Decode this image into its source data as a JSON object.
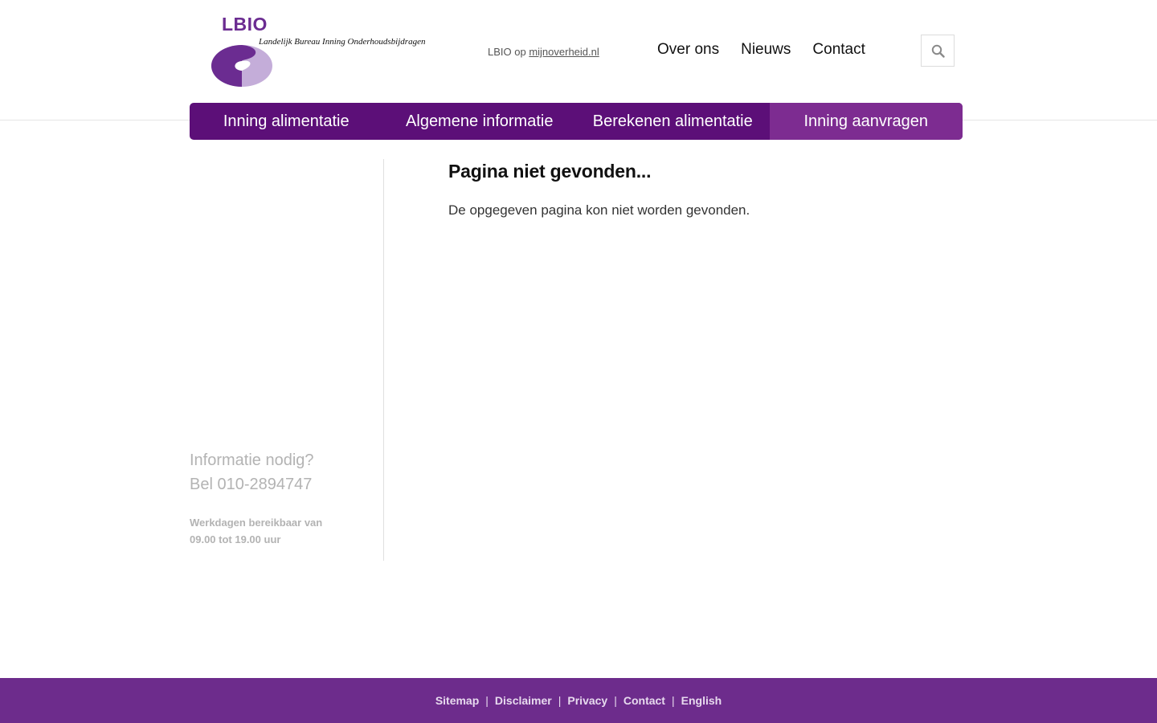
{
  "brand": {
    "name": "LBIO",
    "full_name": "Landelijk Bureau Inning Onderhoudsbijdragen",
    "primary_color": "#5c0f78",
    "accent_color": "#7d2c91",
    "footer_color": "#6d2c8c"
  },
  "header": {
    "mijn_prefix": "LBIO op",
    "mijn_link": "mijnoverheid.nl",
    "top_links": [
      "Over ons",
      "Nieuws",
      "Contact"
    ],
    "search_icon": "search-icon"
  },
  "main_nav": {
    "tabs": [
      {
        "label": "Inning alimentatie",
        "active": false
      },
      {
        "label": "Algemene informatie",
        "active": false
      },
      {
        "label": "Berekenen alimentatie",
        "active": false
      },
      {
        "label": "Inning aanvragen",
        "active": true
      }
    ]
  },
  "sidebar": {
    "info_line1": "Informatie nodig?",
    "info_line2": "Bel 010-2894747",
    "hours_line1": "Werkdagen bereikbaar van",
    "hours_line2": "09.00 tot 19.00 uur"
  },
  "content": {
    "title": "Pagina niet gevonden...",
    "body": "De opgegeven pagina kon niet worden gevonden."
  },
  "footer": {
    "links": [
      "Sitemap",
      "Disclaimer",
      "Privacy",
      "Contact",
      "English"
    ],
    "separator": "|"
  }
}
